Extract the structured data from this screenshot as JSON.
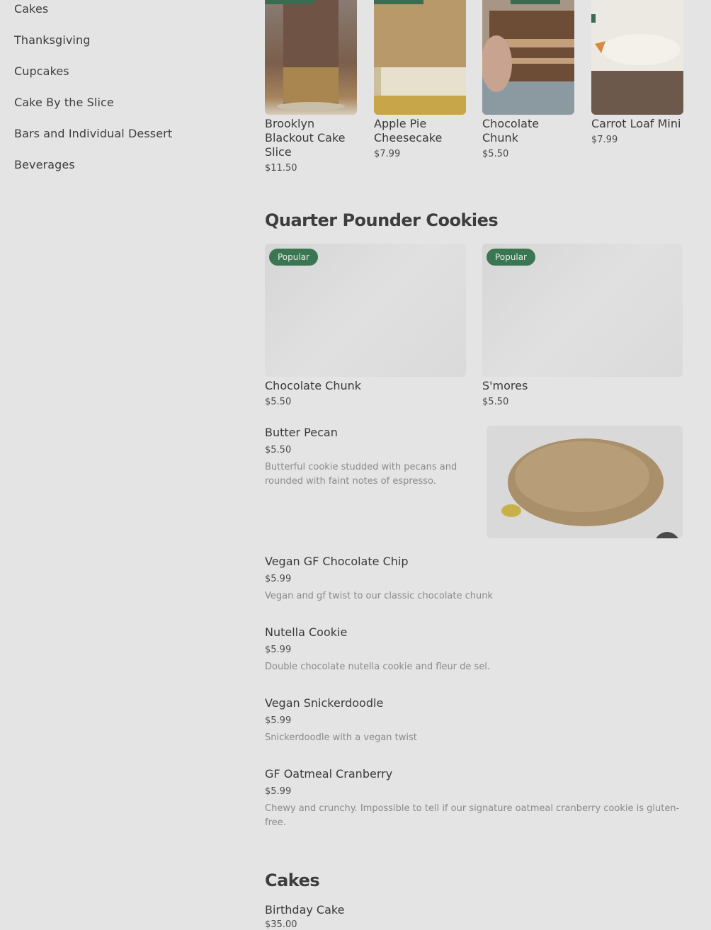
{
  "sidebar": {
    "items": [
      {
        "label": "Cakes"
      },
      {
        "label": "Thanksgiving"
      },
      {
        "label": "Cupcakes"
      },
      {
        "label": "Cake By the Slice"
      },
      {
        "label": "Bars and Individual Dessert"
      },
      {
        "label": "Beverages"
      }
    ]
  },
  "top_row": [
    {
      "name": "Brooklyn Blackout Cake Slice",
      "price": "$11.50"
    },
    {
      "name": "Apple Pie Cheesecake",
      "price": "$7.99"
    },
    {
      "name": "Chocolate Chunk",
      "price": "$5.50"
    },
    {
      "name": "Carrot Loaf Mini",
      "price": "$7.99"
    }
  ],
  "quarter_pounder": {
    "title": "Quarter Pounder Cookies",
    "cards": [
      {
        "badge": "Popular",
        "name": "Chocolate Chunk",
        "price": "$5.50"
      },
      {
        "badge": "Popular",
        "name": "S'mores",
        "price": "$5.50"
      }
    ],
    "list": [
      {
        "name": "Butter Pecan",
        "price": "$5.50",
        "desc": "Butterful cookie studded with pecans and rounded with faint notes of espresso."
      },
      {
        "name": "Vegan GF Chocolate Chip",
        "price": "$5.99",
        "desc": "Vegan and gf twist to our classic chocolate chunk"
      },
      {
        "name": "Nutella Cookie",
        "price": "$5.99",
        "desc": "Double chocolate nutella cookie and fleur de sel."
      },
      {
        "name": "Vegan Snickerdoodle",
        "price": "$5.99",
        "desc": "Snickerdoodle with a vegan twist"
      },
      {
        "name": "GF Oatmeal Cranberry",
        "price": "$5.99",
        "desc": "Chewy and crunchy. Impossible to tell if our signature oatmeal cranberry cookie is gluten-free."
      }
    ]
  },
  "cakes": {
    "title": "Cakes",
    "first_item": {
      "name": "Birthday Cake",
      "price": "$35.00"
    }
  }
}
